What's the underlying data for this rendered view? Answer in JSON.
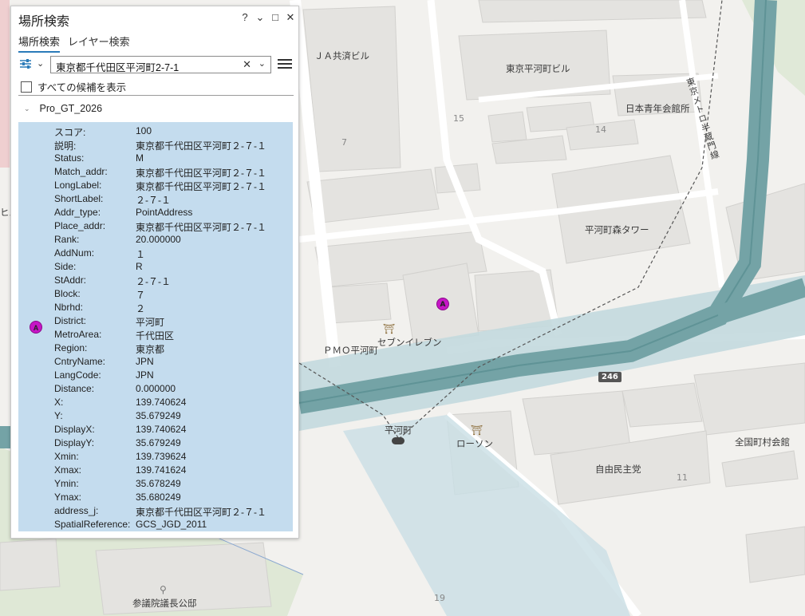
{
  "map": {
    "labels": {
      "ja_building": "ＪＡ共済ビル",
      "tokyo_hirakawacho_building": "東京平河町ビル",
      "nihon_seinen_kaikan": "日本青年会館所",
      "hirakawacho_mori_tower": "平河町森タワー",
      "pmo_hirakawacho": "ＰＭＯ平河町",
      "seven_eleven": "セブンイレブン",
      "hirakawacho": "平河町",
      "lawson": "ローソン",
      "jiminto": "自由民主党",
      "zenkoku_chosonkaikan": "全国町村会館",
      "sangiin_residence": "参議院議長公邸",
      "metro_line": "東京メトロ半蔵門線",
      "edge_label": "ヒル",
      "block_7": "7",
      "block_15": "15",
      "block_14": "14",
      "block_11": "11",
      "block_19": "19",
      "route_246": "246",
      "marker": "A"
    }
  },
  "panel": {
    "title": "場所検索",
    "controls": {
      "help": "?",
      "options": "⌄",
      "maximize": "□",
      "close": "✕"
    },
    "tabs": [
      "場所検索",
      "レイヤー検索"
    ],
    "search": {
      "value": "東京都千代田区平河町2-7-1",
      "clear": "✕",
      "dropdown": "⌄"
    },
    "show_all_candidates": "すべての候補を表示",
    "group_name": "Pro_GT_2026",
    "result_marker": "A",
    "attributes": [
      {
        "name": "スコア:",
        "value": "100"
      },
      {
        "name": "説明:",
        "value": "東京都千代田区平河町２-７-１"
      },
      {
        "name": "Status:",
        "value": "M"
      },
      {
        "name": "Match_addr:",
        "value": "東京都千代田区平河町２-７-１"
      },
      {
        "name": "LongLabel:",
        "value": "東京都千代田区平河町２-７-１"
      },
      {
        "name": "ShortLabel:",
        "value": "２-７-１"
      },
      {
        "name": "Addr_type:",
        "value": "PointAddress"
      },
      {
        "name": "Place_addr:",
        "value": "東京都千代田区平河町２-７-１"
      },
      {
        "name": "Rank:",
        "value": "20.000000"
      },
      {
        "name": "AddNum:",
        "value": "１"
      },
      {
        "name": "Side:",
        "value": "R"
      },
      {
        "name": "StAddr:",
        "value": "２-７-１"
      },
      {
        "name": "Block:",
        "value": "７"
      },
      {
        "name": "Nbrhd:",
        "value": "２"
      },
      {
        "name": "District:",
        "value": "平河町"
      },
      {
        "name": "MetroArea:",
        "value": "千代田区"
      },
      {
        "name": "Region:",
        "value": "東京都"
      },
      {
        "name": "CntryName:",
        "value": "JPN"
      },
      {
        "name": "LangCode:",
        "value": "JPN"
      },
      {
        "name": "Distance:",
        "value": "0.000000"
      },
      {
        "name": "X:",
        "value": "139.740624"
      },
      {
        "name": "Y:",
        "value": "35.679249"
      },
      {
        "name": "DisplayX:",
        "value": "139.740624"
      },
      {
        "name": "DisplayY:",
        "value": "35.679249"
      },
      {
        "name": "Xmin:",
        "value": "139.739624"
      },
      {
        "name": "Xmax:",
        "value": "139.741624"
      },
      {
        "name": "Ymin:",
        "value": "35.678249"
      },
      {
        "name": "Ymax:",
        "value": "35.680249"
      },
      {
        "name": "address_j:",
        "value": "東京都千代田区平河町２-７-１"
      },
      {
        "name": "SpatialReference:",
        "value": "GCS_JGD_2011"
      }
    ]
  }
}
